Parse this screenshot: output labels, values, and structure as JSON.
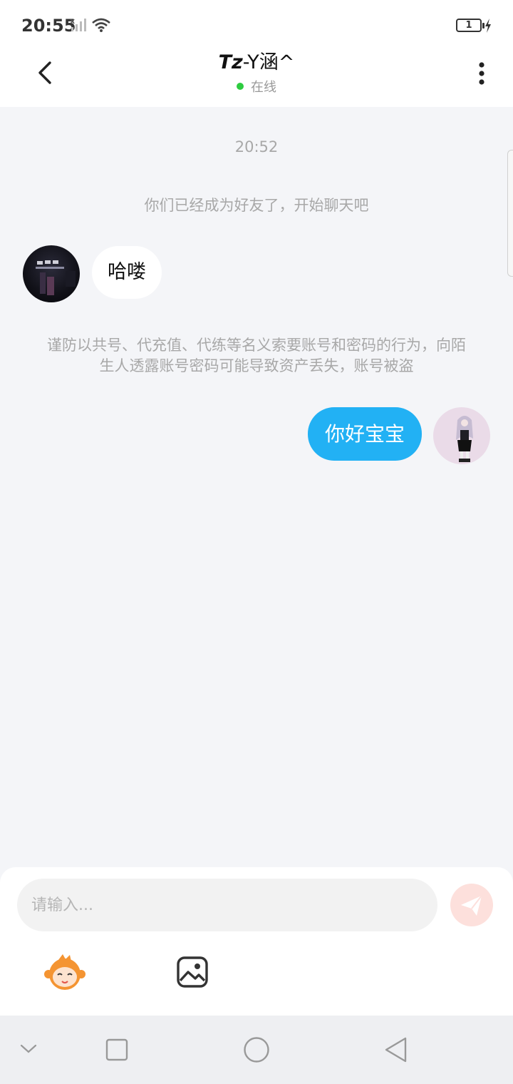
{
  "status_bar": {
    "time": "20:55",
    "battery": "1"
  },
  "header": {
    "title_prefix": "Tz",
    "title_suffix": "-Y涵^",
    "status": "在线",
    "status_color": "#2ecc40"
  },
  "chat": {
    "timestamp": "20:52",
    "system_message": "你们已经成为好友了，开始聊天吧",
    "messages": [
      {
        "side": "left",
        "text": "哈喽"
      },
      {
        "side": "right",
        "text": "你好宝宝"
      }
    ],
    "warning": "谨防以共号、代充值、代练等名义索要账号和密码的行为，向陌生人透露账号密码可能导致资产丢失，账号被盗"
  },
  "input": {
    "placeholder": "请输入..."
  },
  "colors": {
    "accent": "#22b1f4",
    "send_button": "#fde0dc",
    "background": "#f4f5f8"
  },
  "icons": {
    "back": "back-arrow-icon",
    "more": "more-vertical-icon",
    "send": "send-icon",
    "emoji": "emoji-icon",
    "image": "image-icon",
    "nav_down": "chevron-down-icon",
    "nav_recent": "square-icon",
    "nav_home": "circle-icon",
    "nav_back": "triangle-back-icon"
  }
}
